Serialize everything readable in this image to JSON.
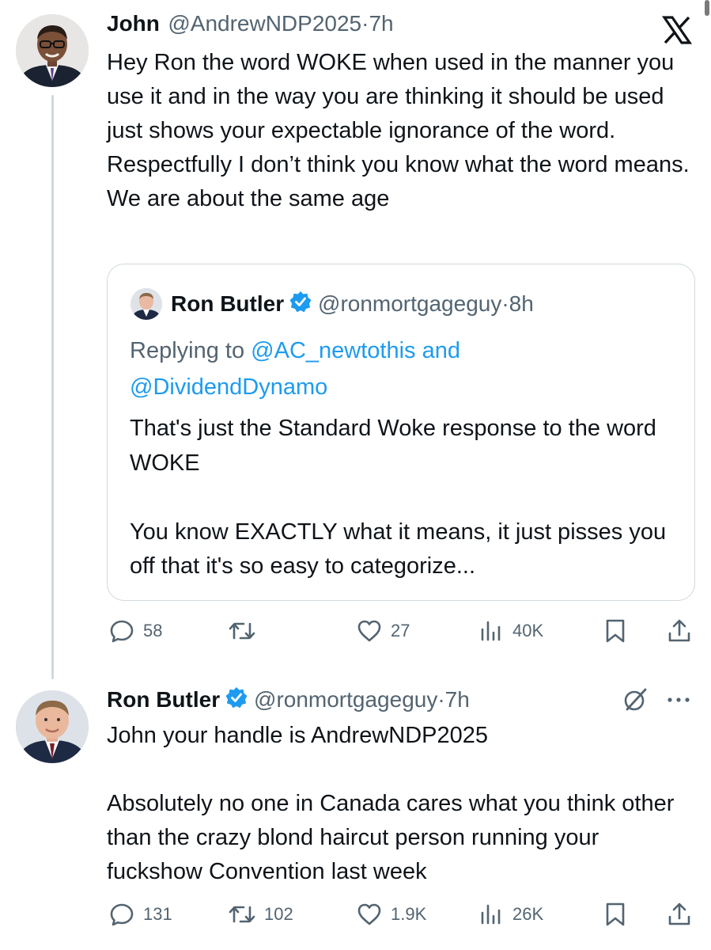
{
  "tweet1": {
    "name": "John",
    "handle": "@AndrewNDP2025",
    "sep": "·",
    "time": "7h",
    "text": "Hey Ron the word WOKE when used in the manner you use it and in the way you are thinking it should be used just shows your expectable ignorance of the word. Respectfully I don’t think you know what the word means. We are about the same age",
    "close_icon": "x-logo-icon",
    "quote": {
      "name": "Ron Butler",
      "handle": "@ronmortgageguy",
      "sep": "·",
      "time": "8h",
      "replying_prefix": "Replying to",
      "replying_to_1": "@AC_newtothis",
      "replying_and": "and",
      "replying_to_2": "@DividendDynamo",
      "text": "That's just the Standard Woke response to the word WOKE\n\nYou know EXACTLY what it means, it just pisses you off that it's so easy to categorize..."
    },
    "actions": {
      "replies": "58",
      "retweets": "",
      "likes": "27",
      "views": "40K"
    }
  },
  "tweet2": {
    "name": "Ron Butler",
    "handle": "@ronmortgageguy",
    "sep": "·",
    "time": "7h",
    "text": "John your handle is AndrewNDP2025\n\nAbsolutely no one in Canada cares what you think other than the crazy blond haircut person running your fuckshow Convention last week",
    "actions": {
      "replies": "131",
      "retweets": "102",
      "likes": "1.9K",
      "views": "26K"
    }
  },
  "colors": {
    "text": "#0f1419",
    "muted": "#536471",
    "link": "#1d9bf0",
    "verified": "#1d9bf0",
    "border": "#cfd9de"
  }
}
